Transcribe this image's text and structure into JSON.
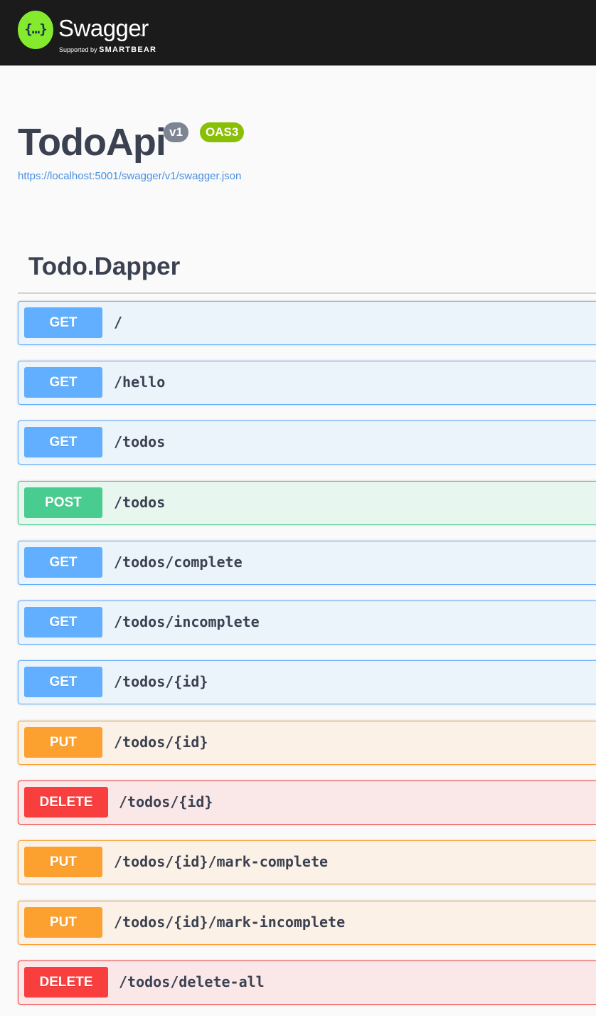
{
  "header": {
    "logo_glyph": "{…}",
    "brand_name": "Swagger",
    "brand_tm": "™",
    "supported_by": "Supported by",
    "company": "SMARTBEAR",
    "colors": {
      "bar": "#1b1b1b",
      "logo": "#85ea2d"
    }
  },
  "info": {
    "title": "TodoApi",
    "version": "v1",
    "oas": "OAS3",
    "spec_url": "https://localhost:5001/swagger/v1/swagger.json"
  },
  "tag": {
    "name": "Todo.Dapper"
  },
  "operations": [
    {
      "method": "GET",
      "path": "/"
    },
    {
      "method": "GET",
      "path": "/hello"
    },
    {
      "method": "GET",
      "path": "/todos"
    },
    {
      "method": "POST",
      "path": "/todos"
    },
    {
      "method": "GET",
      "path": "/todos/complete"
    },
    {
      "method": "GET",
      "path": "/todos/incomplete"
    },
    {
      "method": "GET",
      "path": "/todos/{id}"
    },
    {
      "method": "PUT",
      "path": "/todos/{id}"
    },
    {
      "method": "DELETE",
      "path": "/todos/{id}"
    },
    {
      "method": "PUT",
      "path": "/todos/{id}/mark-complete"
    },
    {
      "method": "PUT",
      "path": "/todos/{id}/mark-incomplete"
    },
    {
      "method": "DELETE",
      "path": "/todos/delete-all"
    }
  ],
  "method_colors": {
    "GET": "#61affe",
    "POST": "#49cc90",
    "PUT": "#fca130",
    "DELETE": "#f93e3e"
  }
}
